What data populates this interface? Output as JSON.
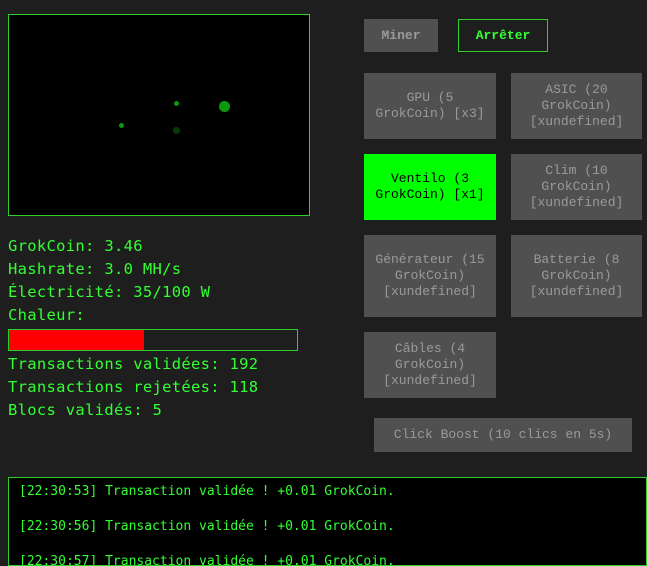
{
  "controls": {
    "mine_label": "Miner",
    "stop_label": "Arrêter"
  },
  "stats": {
    "grokcoin": "GrokCoin: 3.46",
    "hashrate": "Hashrate: 3.0 MH/s",
    "electricity": "Électricité: 35/100 W",
    "heat_label": "Chaleur:",
    "heat_level": 0.47,
    "tx_valid": "Transactions validées: 192",
    "tx_rejected": "Transactions rejetées: 118",
    "blocks": "Blocs validés: 5"
  },
  "shop": {
    "gpu": "GPU (5 GrokCoin) [x3]",
    "asic": "ASIC (20 GrokCoin) [xundefined]",
    "fan": "Ventilo (3 GrokCoin) [x1]",
    "ac": "Clim (10 GrokCoin) [xundefined]",
    "generator": "Générateur (15 GrokCoin) [xundefined]",
    "battery": "Batterie (8 GrokCoin) [xundefined]",
    "cables": "Câbles (4 GrokCoin) [xundefined]"
  },
  "boost_label": "Click Boost (10 clics en 5s)",
  "log": [
    "[22:30:53] Transaction validée ! +0.01 GrokCoin.",
    "[22:30:56] Transaction validée ! +0.01 GrokCoin.",
    "[22:30:57] Transaction validée ! +0.01 GrokCoin."
  ],
  "colors": {
    "accent": "#33ff33",
    "active": "#00ff00",
    "heat": "#ff0000",
    "button": "#505050"
  }
}
